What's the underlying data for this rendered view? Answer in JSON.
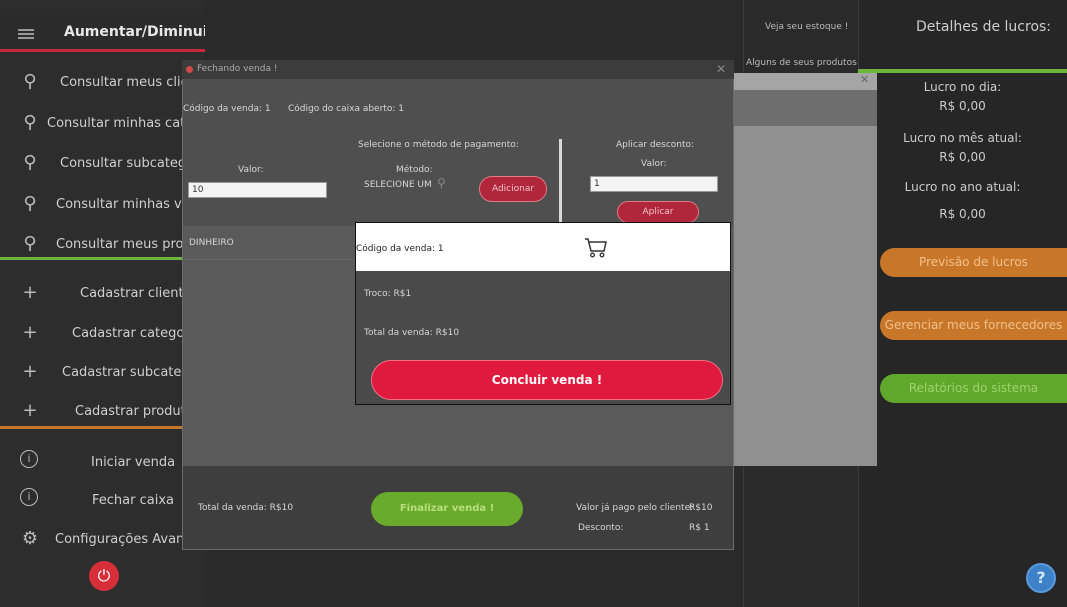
{
  "sidebar": {
    "title": "Aumentar/Diminuir",
    "items": [
      {
        "label": "Consultar meus clientes",
        "icon": "search-icon"
      },
      {
        "label": "Consultar minhas categorias",
        "icon": "search-icon"
      },
      {
        "label": "Consultar subcategorias",
        "icon": "search-icon"
      },
      {
        "label": "Consultar minhas vendas",
        "icon": "search-icon"
      },
      {
        "label": "Consultar meus produtos",
        "icon": "search-icon"
      },
      {
        "label": "Cadastrar cliente",
        "icon": "plus-icon"
      },
      {
        "label": "Cadastrar categoria",
        "icon": "plus-icon"
      },
      {
        "label": "Cadastrar subcategoria",
        "icon": "plus-icon"
      },
      {
        "label": "Cadastrar produto",
        "icon": "plus-icon"
      },
      {
        "label": "Iniciar venda",
        "icon": "info-icon"
      },
      {
        "label": "Fechar caixa",
        "icon": "info-icon"
      },
      {
        "label": "Configurações Avançadas",
        "icon": "gear-icon"
      }
    ]
  },
  "stock": {
    "title": "Veja seu estoque !",
    "subtitle": "Alguns de seus produtos"
  },
  "profit": {
    "title": "Detalhes de lucros:",
    "day_label": "Lucro no dia:",
    "day_value": "R$ 0,00",
    "month_label": "Lucro no mês atual:",
    "month_value": "R$ 0,00",
    "year_label": "Lucro no ano atual:",
    "year_value": "R$ 0,00",
    "forecast_button": "Previsão de lucros",
    "suppliers_button": "Gerenciar meus fornecedores",
    "reports_button": "Relatórios do sistema"
  },
  "dialog": {
    "title": "Fechando venda !",
    "sale_code": "Código da venda: 1",
    "cash_code": "Código do caixa aberto: 1",
    "payment_header": "Selecione o método de pagamento:",
    "value_label": "Valor:",
    "value_input": "10",
    "method_label": "Método:",
    "method_value": "SELECIONE UM",
    "add_button": "Adicionar",
    "discount_header": "Aplicar desconto:",
    "discount_value_label": "Valor:",
    "discount_input": "1",
    "apply_button": "Aplicar",
    "payments": [
      "DINHEIRO"
    ],
    "total_label": "Total da venda: R$10",
    "finalize_button": "Finalizar venda !",
    "paid_label": "Valor já pago pelo cliente:",
    "paid_value": "R$10",
    "discount_label": "Desconto:",
    "discount_amount": "R$ 1"
  },
  "popup": {
    "sale_code": "Código da venda: 1",
    "change": "Troco: R$1",
    "total": "Total da venda: R$10",
    "conclude_button": "Concluir venda !"
  },
  "colors": {
    "accent_red": "#c7283b",
    "accent_green": "#6fb43a",
    "accent_orange": "#c8772a",
    "conclude_red": "#e01a3f",
    "finalize_green": "#6aaa2d"
  }
}
